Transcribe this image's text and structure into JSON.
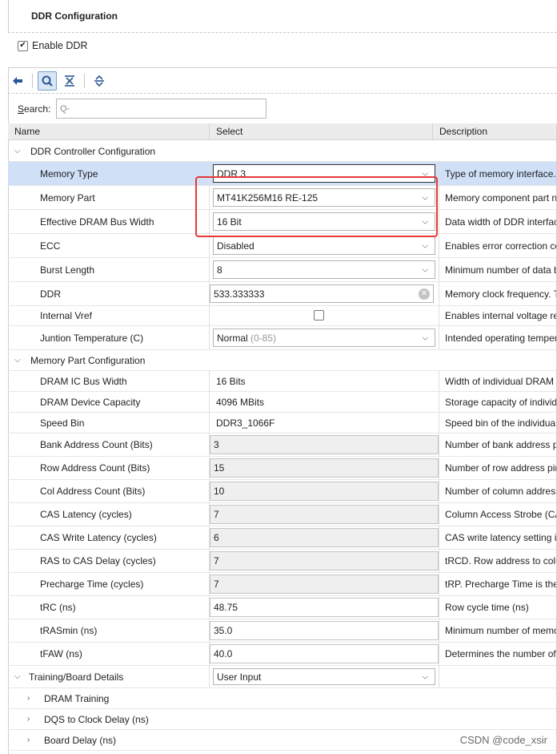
{
  "window": {
    "title": "DDR Configuration"
  },
  "enable_ddr": {
    "label": "Enable DDR",
    "checked": true
  },
  "toolbar": {
    "icons": [
      "back-arrow-icon",
      "search-icon",
      "collapse-all-icon",
      "expand-all-icon"
    ]
  },
  "search": {
    "label_prefix": "S",
    "label_rest": "earch:",
    "placeholder": "Q-"
  },
  "columns": {
    "name": "Name",
    "select": "Select",
    "description": "Description"
  },
  "groups": {
    "ddr_controller": "DDR Controller Configuration",
    "memory_part": "Memory Part Configuration",
    "training_board": "Training/Board Details"
  },
  "rows": {
    "memory_type": {
      "name": "Memory Type",
      "value": "DDR 3",
      "desc": "Type of memory interface. Refer"
    },
    "memory_part": {
      "name": "Memory Part",
      "value": "MT41K256M16 RE-125",
      "desc": "Memory component part number"
    },
    "bus_width": {
      "name": "Effective DRAM Bus Width",
      "value": "16 Bit",
      "desc": "Data width of DDR interface"
    },
    "ecc": {
      "name": "ECC",
      "value": "Disabled",
      "desc": "Enables error correction code"
    },
    "burst_length": {
      "name": "Burst Length",
      "value": "8",
      "desc": "Minimum number of data beats"
    },
    "ddr": {
      "name": "DDR",
      "value": "533.333333",
      "desc": "Memory clock frequency. The"
    },
    "internal_vref": {
      "name": "Internal Vref",
      "checked": false,
      "desc": "Enables internal voltage reference"
    },
    "junction_temp": {
      "name": "Juntion Temperature (C)",
      "value": "Normal",
      "value_sub": "(0-85)",
      "desc": "Intended operating temperature"
    },
    "dram_ic_bus_width": {
      "name": "DRAM IC Bus Width",
      "value": "16 Bits",
      "desc": "Width of individual DRAM component"
    },
    "dram_device_capacity": {
      "name": "DRAM Device Capacity",
      "value": "4096 MBits",
      "desc": "Storage capacity of individual"
    },
    "speed_bin": {
      "name": "Speed Bin",
      "value": "DDR3_1066F",
      "desc": "Speed bin of the individual DRAM"
    },
    "bank_addr": {
      "name": "Bank Address Count (Bits)",
      "value": "3",
      "desc": "Number of bank address pins"
    },
    "row_addr": {
      "name": "Row Address Count (Bits)",
      "value": "15",
      "desc": "Number of row address pins"
    },
    "col_addr": {
      "name": "Col Address Count (Bits)",
      "value": "10",
      "desc": "Number of column address pins"
    },
    "cas_latency": {
      "name": "CAS Latency (cycles)",
      "value": "7",
      "desc": "Column Access Strobe (CAS)"
    },
    "cas_write_latency": {
      "name": "CAS Write Latency (cycles)",
      "value": "6",
      "desc": "CAS write latency setting in"
    },
    "ras_to_cas": {
      "name": "RAS to CAS Delay (cycles)",
      "value": "7",
      "desc": "tRCD. Row address to column"
    },
    "precharge": {
      "name": "Precharge Time (cycles)",
      "value": "7",
      "desc": "tRP. Precharge Time is the"
    },
    "trc": {
      "name": "tRC (ns)",
      "value": "48.75",
      "desc": "Row cycle time (ns)"
    },
    "trasmin": {
      "name": "tRASmin (ns)",
      "value": "35.0",
      "desc": "Minimum number of memory"
    },
    "tfaw": {
      "name": "tFAW (ns)",
      "value": "40.0",
      "desc": "Determines the number of activ"
    },
    "training_board": {
      "value": "User Input"
    },
    "dram_training": {
      "name": "DRAM Training"
    },
    "dqs_clock_delay": {
      "name": "DQS to Clock Delay (ns)"
    },
    "board_delay": {
      "name": "Board Delay (ns)"
    }
  },
  "watermark": "CSDN @code_xsir",
  "colors": {
    "selection": "#cfe0f7",
    "highlight_border": "#e53935",
    "header_bg": "#ececec"
  }
}
